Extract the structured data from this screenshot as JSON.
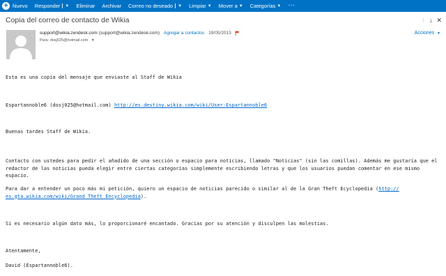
{
  "toolbar": {
    "new_label": "Nuevo",
    "reply_label": "Responder",
    "delete_label": "Eliminar",
    "archive_label": "Archivar",
    "junk_label": "Correo no deseado",
    "sweep_label": "Limpiar",
    "move_label": "Mover a",
    "categories_label": "Categorías",
    "more_label": "···"
  },
  "message": {
    "subject": "Copia del correo de contacto de Wikia",
    "sender_name": "support@wikia.zendesk.com",
    "sender_email": "(support@wikia.zendesk.com)",
    "add_contact": "Agregar a contactos",
    "date": "19/05/2013",
    "to_label": "Para:",
    "to_value": "dosj025@hotmail.com",
    "actions_label": "Acciones"
  },
  "body": {
    "p1": "Esta es una copia del mensaje que enviaste al Staff de Wikia",
    "p2_text": "Espartannoble6 (dosj025@hotmail.com) ",
    "p2_link": "http://es.destiny.wikia.com/wiki/User:Espartannoble6",
    "p3": "Buenas tardes Staff de Wikia.",
    "p4_l1": "Contacto con ustedes para pedir el añadido de una sección o espacio para noticias, llamado \"Noticias\" (sin las comillas). Además me gustaría que el",
    "p4_l2": "redactor de las noticias pueda elegir entre ciertas categorías simplemente escribiendo letras y que los usuarios puedan comentar en ese mismo",
    "p4_l3": "espacio.",
    "p5_l1": "Para dar a entender un poco más mi petición, quiero un espacio de noticias parecido o similar al de la Gran Theft Ecyclopedia (",
    "p5_link1": "http://",
    "p5_link2": "es.gta.wikia.com/wiki/Grand_Theft_Encyclopedia",
    "p5_end": ").",
    "p6": "Si es necesario algún dato más, lo proporcionaré encantado. Gracias por su atención y disculpen las molestias.",
    "p7": "Atentamente,",
    "p8": "David (Espartannoble6)."
  },
  "colors": {
    "toolbar_bg": "#0072c6",
    "link": "#0066cc",
    "flag": "#e03a1e"
  }
}
